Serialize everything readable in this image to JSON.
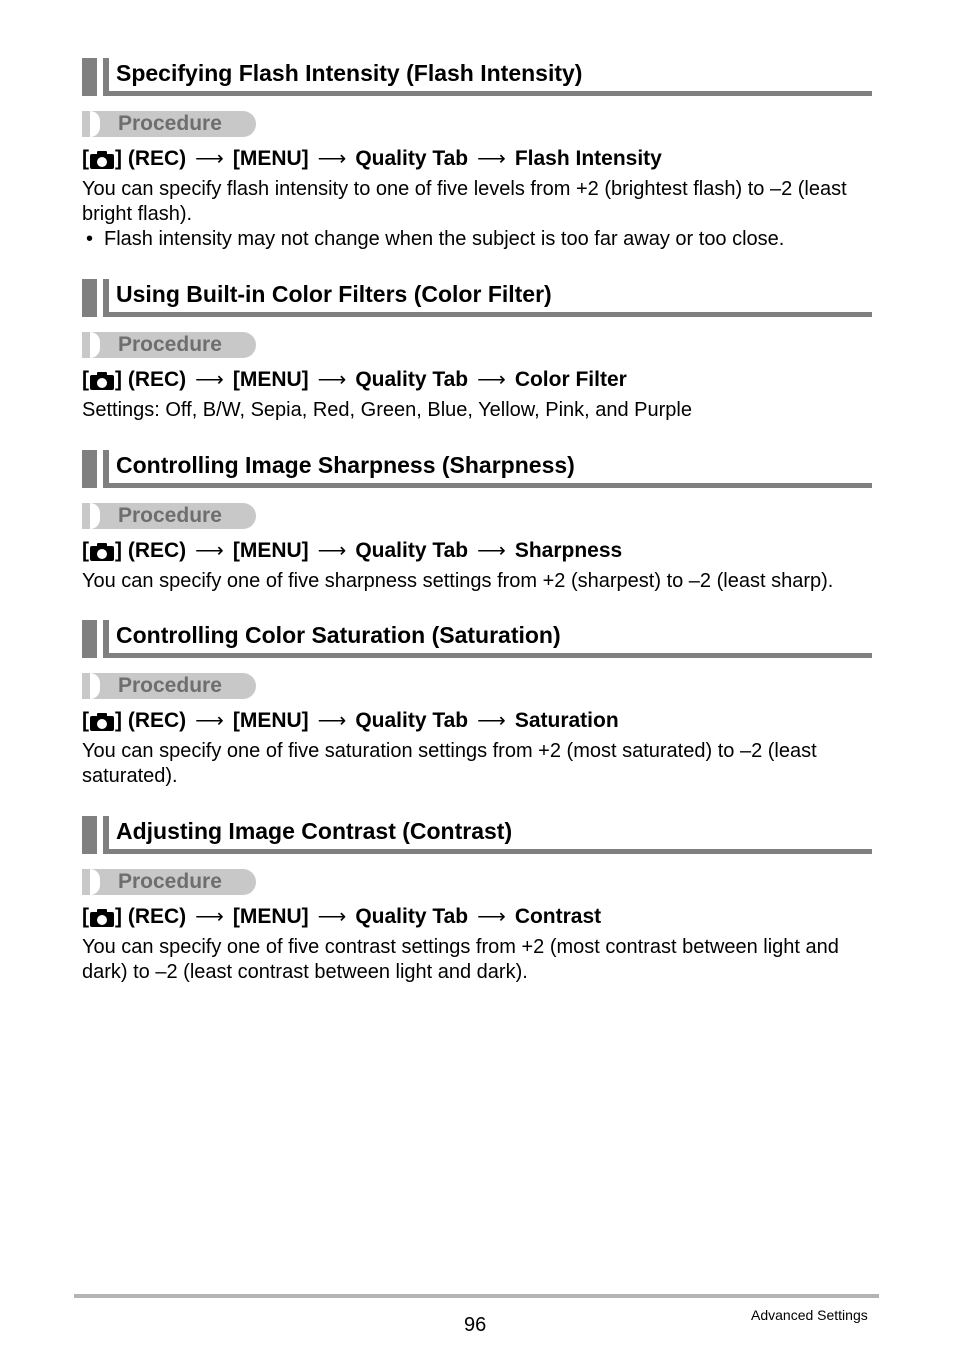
{
  "procedure_label": "Procedure",
  "path_common": {
    "open_bracket": "[",
    "close_bracket": "]",
    "rec": "(REC)",
    "arrow": "⟶",
    "menu": "[MENU]",
    "tab": "Quality Tab"
  },
  "sections": [
    {
      "title": "Specifying Flash Intensity (Flash Intensity)",
      "target": "Flash Intensity",
      "text": "You can specify flash intensity to one of five levels from +2 (brightest flash) to –2 (least bright flash).",
      "bullets": [
        "Flash intensity may not change when the subject is too far away or too close."
      ]
    },
    {
      "title": "Using Built-in Color Filters (Color Filter)",
      "target": "Color Filter",
      "text": "Settings: Off, B/W, Sepia, Red, Green, Blue, Yellow, Pink, and Purple"
    },
    {
      "title": "Controlling Image Sharpness (Sharpness)",
      "target": "Sharpness",
      "text": "You can specify one of five sharpness settings from +2 (sharpest) to –2 (least sharp)."
    },
    {
      "title": "Controlling Color Saturation (Saturation)",
      "target": "Saturation",
      "text": "You can specify one of five saturation settings from +2 (most saturated) to –2 (least saturated)."
    },
    {
      "title": "Adjusting Image Contrast (Contrast)",
      "target": "Contrast",
      "text": "You can specify one of five contrast settings from +2 (most contrast between light and dark) to –2 (least contrast between light and dark)."
    }
  ],
  "footer": {
    "page_number": "96",
    "chapter": "Advanced Settings"
  },
  "colors": {
    "heading_bar": "#808080",
    "procedure_pill": "#c8c8c8",
    "procedure_text": "#6e6e6e",
    "footer_rule": "#b4b4b4"
  }
}
